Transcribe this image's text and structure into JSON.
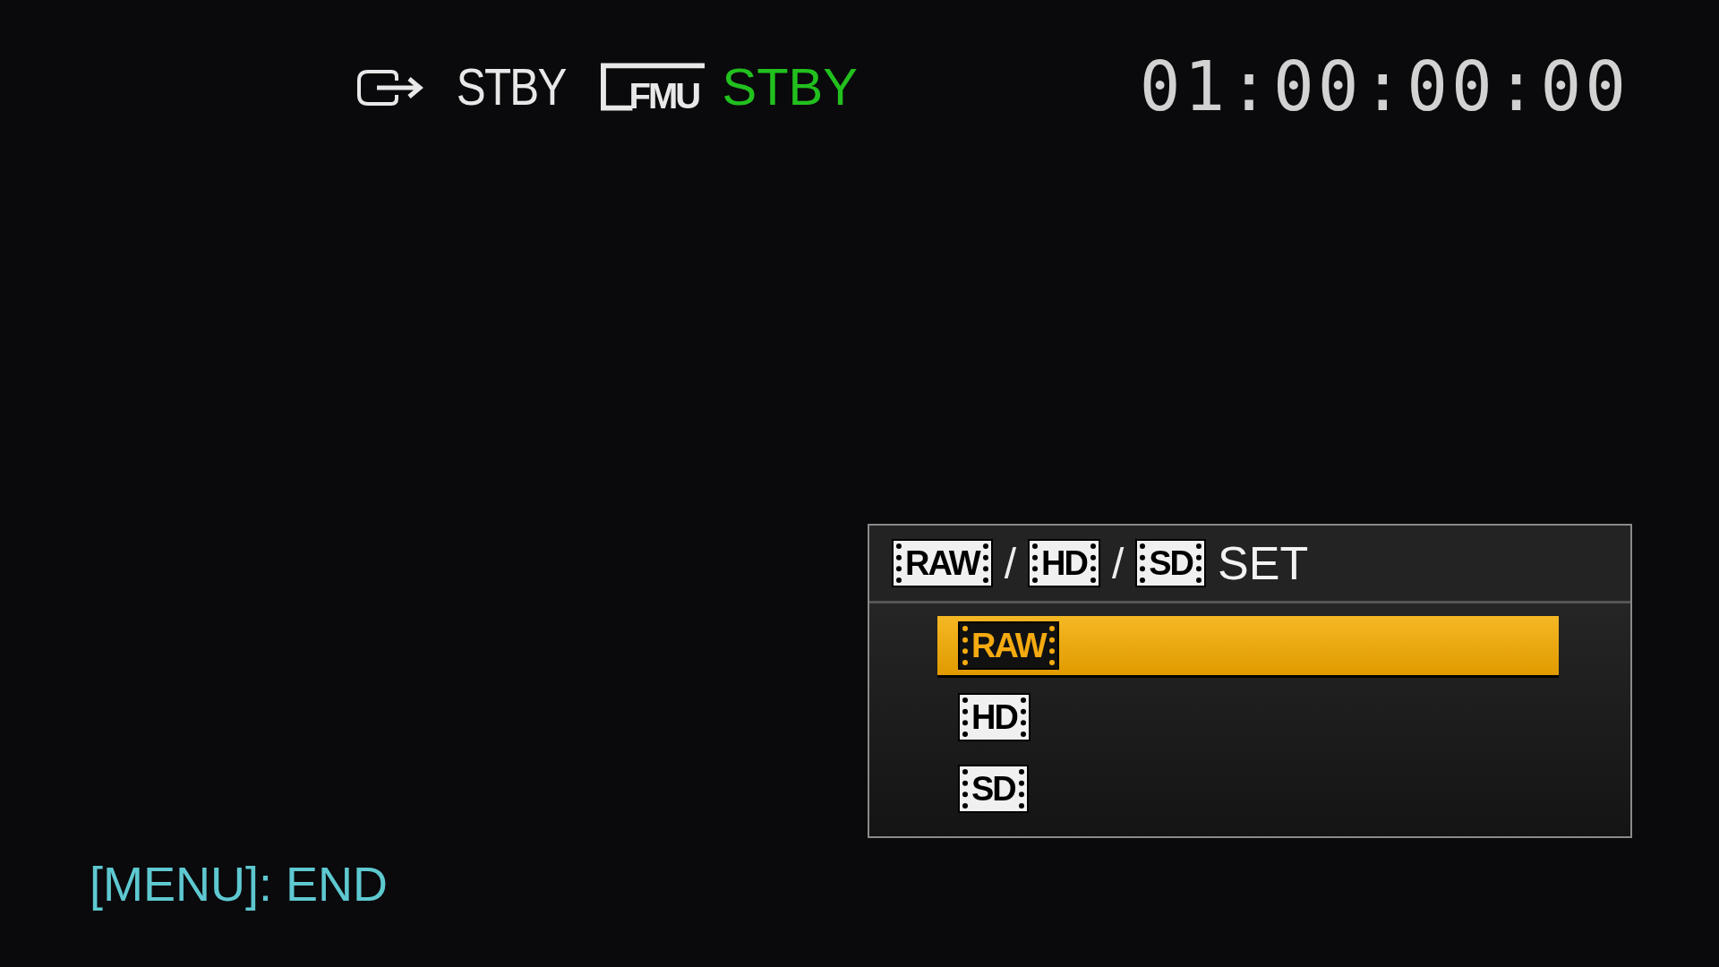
{
  "status": {
    "output_label": "STBY",
    "media_label": "FMU",
    "media_status": "STBY",
    "timecode": "01:00:00:00"
  },
  "menu": {
    "title": [
      {
        "kind": "badge",
        "text": "RAW"
      },
      {
        "kind": "separator",
        "text": "/"
      },
      {
        "kind": "badge",
        "text": "HD"
      },
      {
        "kind": "separator",
        "text": "/"
      },
      {
        "kind": "badge",
        "text": "SD"
      },
      {
        "kind": "text",
        "text": "SET"
      }
    ],
    "options": [
      {
        "label": "RAW",
        "selected": true
      },
      {
        "label": "HD",
        "selected": false
      },
      {
        "label": "SD",
        "selected": false
      }
    ]
  },
  "hint": "[MENU]: END"
}
